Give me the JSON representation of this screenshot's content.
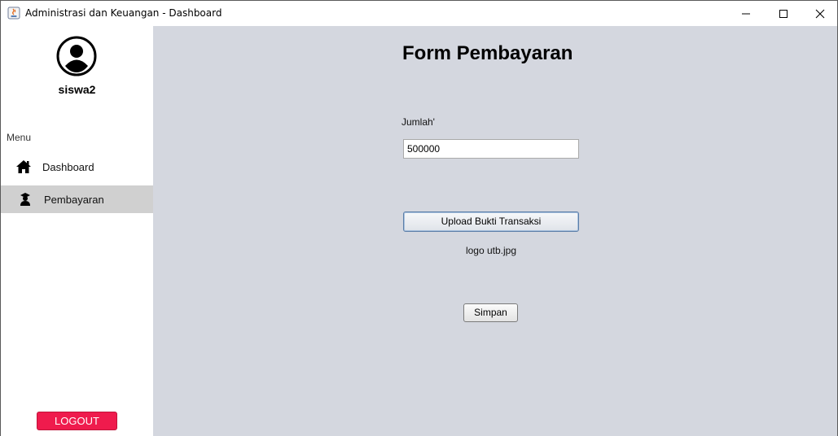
{
  "window": {
    "title": "Administrasi dan Keuangan - Dashboard",
    "controls": [
      "minimize",
      "maximize",
      "close"
    ]
  },
  "sidebar": {
    "username": "siswa2",
    "menu_heading": "Menu",
    "items": [
      {
        "label": "Dashboard",
        "icon": "home-icon",
        "active": false
      },
      {
        "label": "Pembayaran",
        "icon": "graduate-icon",
        "active": true
      }
    ],
    "logout_label": "LOGOUT"
  },
  "form": {
    "title": "Form Pembayaran",
    "amount_label": "Jumlah'",
    "amount_value": "500000",
    "upload_label": "Upload Bukti Transaksi",
    "uploaded_file": "logo utb.jpg",
    "save_label": "Simpan"
  },
  "colors": {
    "main_bg": "#d4d7df",
    "active_item_bg": "#d0d0d0",
    "logout_bg": "#ef1b4d"
  }
}
